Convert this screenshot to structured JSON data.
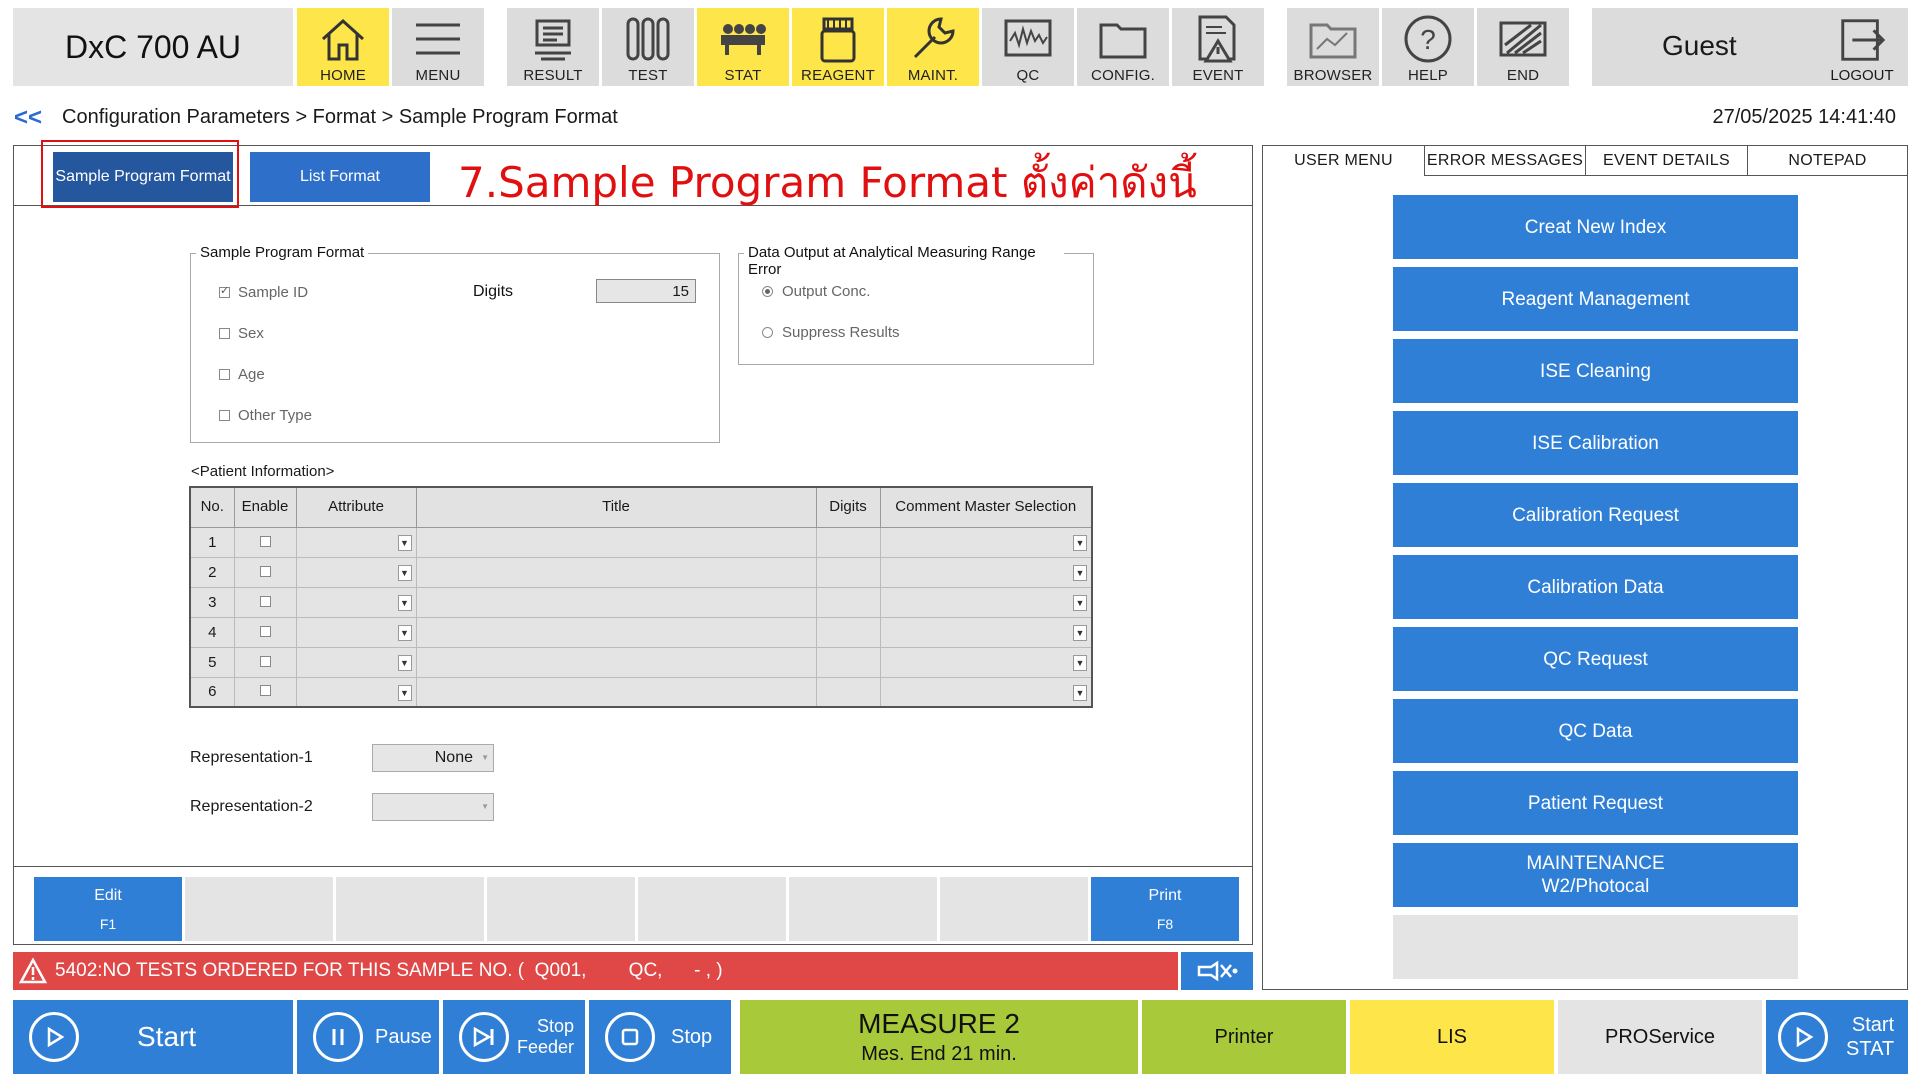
{
  "app": {
    "title": "DxC 700 AU"
  },
  "toolbar": {
    "home": "HOME",
    "menu": "MENU",
    "result": "RESULT",
    "test": "TEST",
    "stat": "STAT",
    "reagent": "REAGENT",
    "maint": "MAINT.",
    "qc": "QC",
    "config": "CONFIG.",
    "event": "EVENT",
    "browser": "BROWSER",
    "help": "HELP",
    "end": "END"
  },
  "user": {
    "name": "Guest",
    "logout": "LOGOUT"
  },
  "breadcrumb": {
    "back": "<<",
    "path": "Configuration Parameters > Format > Sample Program Format"
  },
  "clock": "27/05/2025 14:41:40",
  "subtabs": {
    "sample_program_format": "Sample Program Format",
    "list_format": "List Format"
  },
  "annotation": "7.Sample Program Format ตั้งค่าดังนี้",
  "sample_program_format": {
    "title": "Sample Program Format",
    "sample_id": "Sample ID",
    "sex": "Sex",
    "age": "Age",
    "other_type": "Other Type",
    "digits_label": "Digits",
    "digits_value": "15"
  },
  "data_output": {
    "title": "Data Output at Analytical Measuring Range Error",
    "output_conc": "Output Conc.",
    "suppress_results": "Suppress Results"
  },
  "patient_info": {
    "label": "<Patient Information>",
    "headers": {
      "no": "No.",
      "enable": "Enable",
      "attribute": "Attribute",
      "title": "Title",
      "digits": "Digits",
      "comment": "Comment Master Selection"
    },
    "rows": [
      "1",
      "2",
      "3",
      "4",
      "5",
      "6"
    ]
  },
  "representation": {
    "rep1_label": "Representation-1",
    "rep1_value": "None",
    "rep2_label": "Representation-2",
    "rep2_value": ""
  },
  "fkeys": {
    "edit": "Edit",
    "edit_key": "F1",
    "print": "Print",
    "print_key": "F8"
  },
  "alarm": {
    "message": "5402:NO TESTS ORDERED FOR THIS SAMPLE NO. (  Q001,        QC,      - , )"
  },
  "right_tabs": {
    "user_menu": "USER MENU",
    "error_messages": "ERROR MESSAGES",
    "event_details": "EVENT DETAILS",
    "notepad": "NOTEPAD"
  },
  "user_menu": {
    "b1": "Creat New Index",
    "b2": "Reagent Management",
    "b3": "ISE Cleaning",
    "b4": "ISE Calibration",
    "b5": "Calibration Request",
    "b6": "Calibration Data",
    "b7": "QC Request",
    "b8": "QC Data",
    "b9": "Patient Request",
    "b10a": "MAINTENANCE",
    "b10b": "W2/Photocal"
  },
  "bottom": {
    "start": "Start",
    "pause": "Pause",
    "stop_feeder_1": "Stop",
    "stop_feeder_2": "Feeder",
    "stop": "Stop",
    "measure": "MEASURE 2",
    "measure_sub": "Mes. End 21 min.",
    "printer": "Printer",
    "lis": "LIS",
    "proservice": "PROService",
    "start_stat_1": "Start",
    "start_stat_2": "STAT"
  },
  "colors": {
    "toolbar_yellow": "#fde54a",
    "button_blue": "#2f7fd6",
    "alarm_red": "#e04848",
    "measure_green": "#a8c93a",
    "status_yellow": "#fde54a"
  }
}
